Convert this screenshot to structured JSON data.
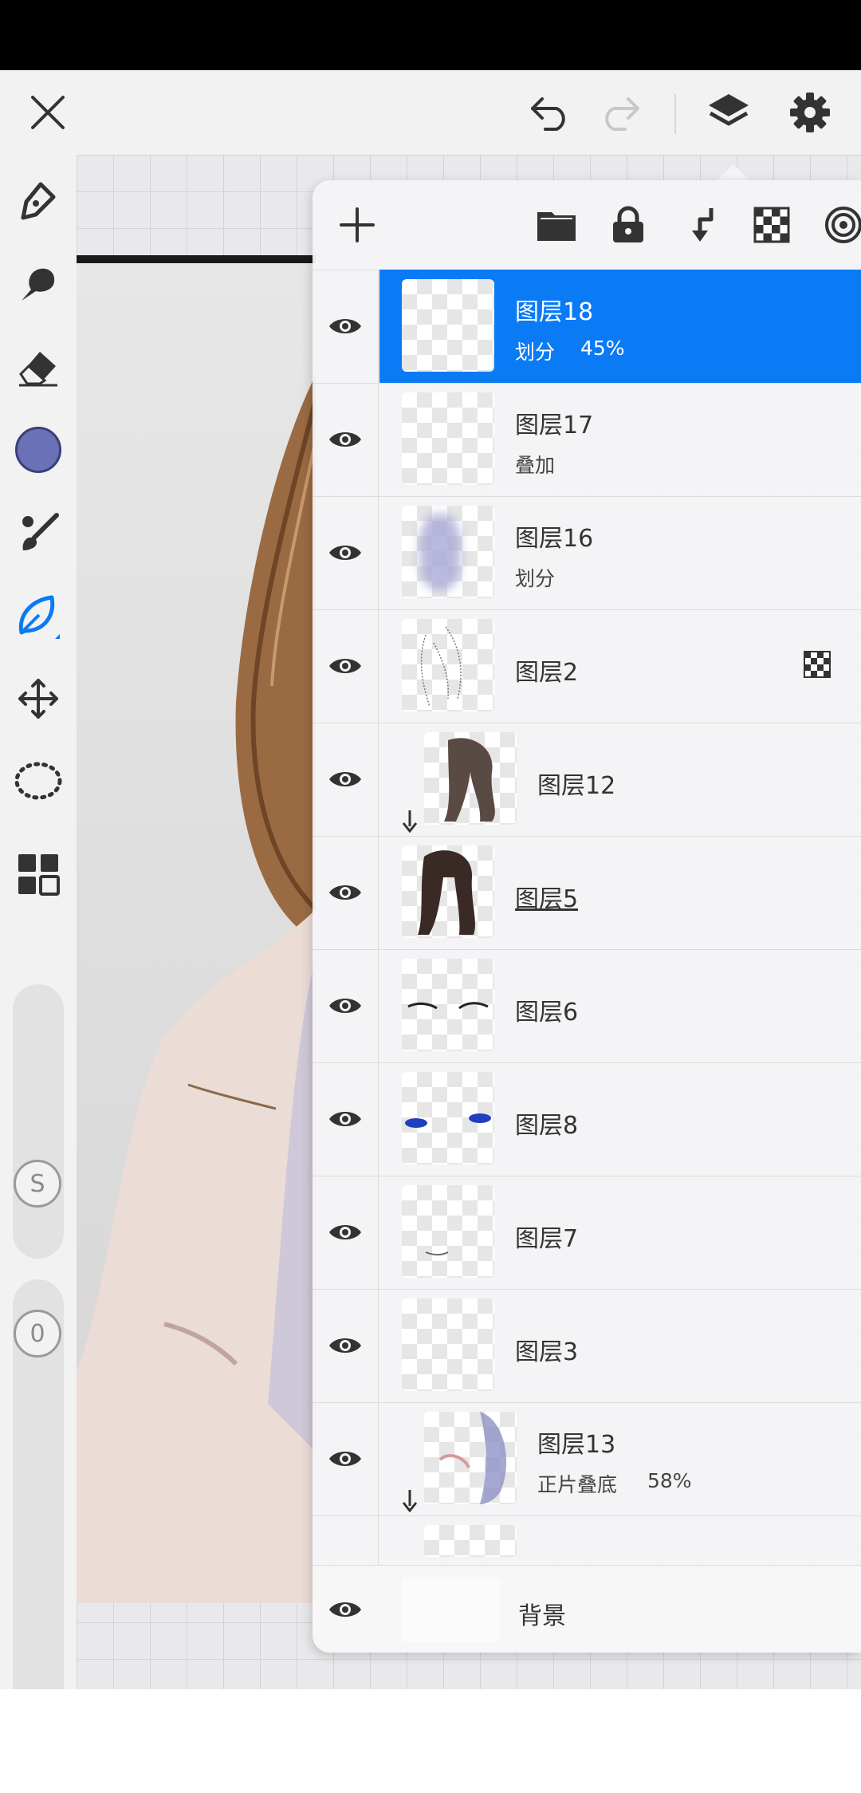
{
  "toolbar": {
    "close": "close-icon",
    "undo": "undo-icon",
    "redo": "redo-icon",
    "layers": "layers-icon",
    "settings": "gear-icon"
  },
  "sidebar": {
    "tools": [
      "pen-icon",
      "blur-icon",
      "eraser-icon",
      "color-swatch",
      "brush-icon",
      "leaf-icon",
      "move-icon",
      "lasso-icon",
      "grid-icon"
    ],
    "color": "#6b71b6",
    "size_label": "S",
    "opacity_label": "0"
  },
  "panel": {
    "header_icons": [
      "add-layer-icon",
      "folder-icon",
      "lock-icon",
      "merge-down-icon",
      "alpha-lock-icon",
      "target-icon"
    ],
    "layers": [
      {
        "name": "图层18",
        "mode": "划分",
        "opacity": "45%",
        "selected": true
      },
      {
        "name": "图层17",
        "mode": "叠加",
        "opacity": ""
      },
      {
        "name": "图层16",
        "mode": "划分",
        "opacity": ""
      },
      {
        "name": "图层2",
        "mode": "",
        "opacity": ""
      },
      {
        "name": "图层12",
        "mode": "",
        "opacity": "",
        "clipped": true
      },
      {
        "name": "图层5",
        "mode": "",
        "opacity": ""
      },
      {
        "name": "图层6",
        "mode": "",
        "opacity": ""
      },
      {
        "name": "图层8",
        "mode": "",
        "opacity": ""
      },
      {
        "name": "图层7",
        "mode": "",
        "opacity": ""
      },
      {
        "name": "图层3",
        "mode": "",
        "opacity": ""
      },
      {
        "name": "图层13",
        "mode": "正片叠底",
        "opacity": "58%",
        "clipped": true
      }
    ],
    "background_label": "背景"
  }
}
